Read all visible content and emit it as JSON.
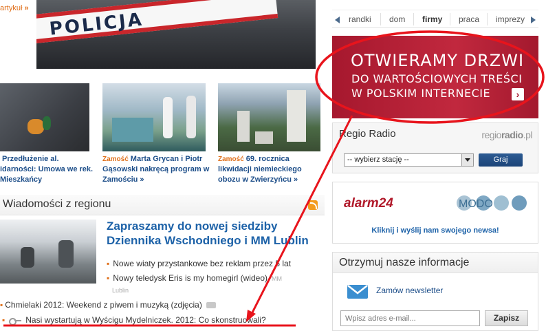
{
  "top": {
    "artykul_link": "artykuł",
    "hero_tape_text": "POLICJA"
  },
  "thumbnails": [
    {
      "city": "",
      "text": "Przedłużenie al. idarności: Umowa we rek. Mieszkańcy"
    },
    {
      "city": "Zamość",
      "text": "Marta Grycan i Piotr Gąsowski nakręcą program w Zamościu »"
    },
    {
      "city": "Zamość",
      "text": "69. rocznica likwidacji niemieckiego obozu w Zwierzyńcu »"
    }
  ],
  "news": {
    "section_title": "Wiadomości z regionu",
    "main_story": "Zapraszamy do nowej siedziby Dziennika Wschodniego i MM Lublin",
    "sub_items": [
      {
        "text": "Nowe wiaty przystankowe bez reklam przez 5 lat",
        "source": ""
      },
      {
        "text": "Nowy teledysk Eris is my homegirl (wideo)",
        "source": "MM"
      }
    ],
    "sub_item2_source_line2": "Lublin",
    "bottom_items": [
      "Chmielaki 2012: Weekend z piwem i muzyką (zdjęcia)",
      "Nasi wystartują w Wyścigu Mydelniczek. 2012: Co skonstruowali?"
    ]
  },
  "right": {
    "tabs": [
      "randki",
      "dom",
      "firmy",
      "praca",
      "imprezy"
    ],
    "active_tab": "firmy",
    "banner": {
      "line1": "OTWIERAMY DRZWI",
      "line2": "DO WARTOŚCIOWYCH TREŚCI",
      "line3": "W POLSKIM INTERNECIE",
      "button": "›"
    },
    "radio": {
      "title": "Regio Radio",
      "logo_a": "regio",
      "logo_b": "radio",
      "logo_c": ".pl",
      "select_value": "-- wybierz stację --",
      "button": "Graj"
    },
    "alarm": {
      "logo": "alarm24",
      "modo": "MODO",
      "link": "Kliknij i wyślij nam swojego newsa!"
    },
    "newsletter": {
      "title": "Otrzymuj nasze informacje",
      "link": "Zamów newsletter",
      "placeholder": "Wpisz adres e-mail...",
      "button": "Zapisz"
    }
  },
  "colors": {
    "link_blue": "#1d62a8",
    "accent_orange": "#e0701b",
    "banner_red": "#a6182e",
    "annotation_red": "#e8141c"
  }
}
